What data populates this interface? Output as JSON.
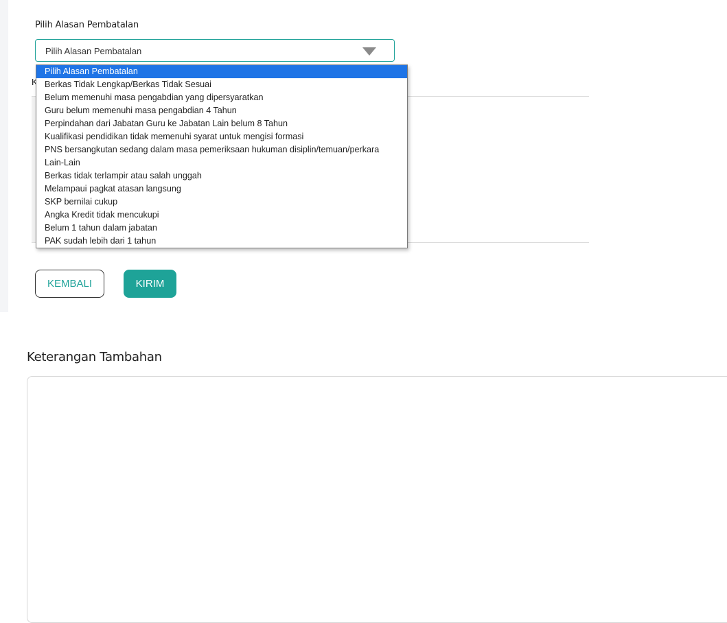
{
  "form": {
    "label": "Pilih Alasan Pembatalan",
    "select_value": "Pilih Alasan Pembatalan",
    "hidden_label": "K",
    "options": [
      "Pilih Alasan Pembatalan",
      "Berkas Tidak Lengkap/Berkas Tidak Sesuai",
      "Belum memenuhi masa pengabdian yang dipersyaratkan",
      "Guru belum memenuhi masa pengabdian 4 Tahun",
      "Perpindahan dari Jabatan Guru ke Jabatan Lain belum 8 Tahun",
      "Kualifikasi pendidikan tidak memenuhi syarat untuk mengisi formasi",
      "PNS bersangkutan sedang dalam masa pemeriksaan hukuman disiplin/temuan/perkara",
      "Lain-Lain",
      "Berkas tidak terlampir atau salah unggah",
      "Melampaui pagkat atasan langsung",
      "SKP bernilai cukup",
      "Angka Kredit tidak mencukupi",
      "Belum 1 tahun dalam jabatan",
      "PAK sudah lebih dari 1 tahun"
    ],
    "selected_index": 0
  },
  "buttons": {
    "back": "KEMBALI",
    "send": "KIRIM"
  },
  "additional": {
    "title": "Keterangan Tambahan"
  },
  "colors": {
    "accent": "#1ea398",
    "selected_option": "#1e74e6"
  }
}
